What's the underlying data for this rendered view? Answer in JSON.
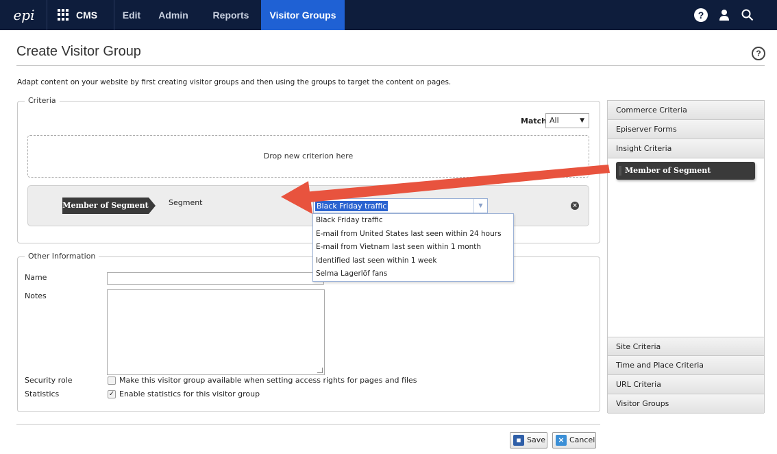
{
  "topbar": {
    "logo": "epi",
    "apps_label": "CMS",
    "nav": [
      "Edit",
      "Admin",
      "Reports",
      "Visitor Groups"
    ],
    "active_nav": "Visitor Groups"
  },
  "page": {
    "title": "Create Visitor Group",
    "help": "?",
    "intro": "Adapt content on your website by first creating visitor groups and then using the groups to target the content on pages."
  },
  "criteria": {
    "legend": "Criteria",
    "match_label": "Match",
    "match_value": "All",
    "drop_text": "Drop new criterion here",
    "criterion": {
      "tag": "Member of Segment",
      "field_label": "Segment",
      "selected": "Black Friday traffic",
      "options": [
        "Black Friday traffic",
        "E-mail from United States last seen within 24 hours",
        "E-mail from Vietnam last seen within 1 month",
        "Identified last seen within 1 week",
        "Selma Lagerlöf fans"
      ]
    }
  },
  "other_info": {
    "legend": "Other Information",
    "name_label": "Name",
    "name_value": "",
    "notes_label": "Notes",
    "notes_value": "",
    "security_label": "Security role",
    "security_text": "Make this visitor group available when setting access rights for pages and files",
    "security_checked": false,
    "statistics_label": "Statistics",
    "statistics_text": "Enable statistics for this visitor group",
    "statistics_checked": true
  },
  "palette": {
    "headers": [
      "Commerce Criteria",
      "Episerver Forms",
      "Insight Criteria",
      "Site Criteria",
      "Time and Place Criteria",
      "URL Criteria",
      "Visitor Groups"
    ],
    "expanded": "Insight Criteria",
    "items": [
      "Member of Segment"
    ]
  },
  "buttons": {
    "save": "Save",
    "cancel": "Cancel"
  },
  "colors": {
    "topbar": "#0e1d3c",
    "active_tab": "#1f61d4",
    "annotation_arrow": "#e8533e"
  }
}
